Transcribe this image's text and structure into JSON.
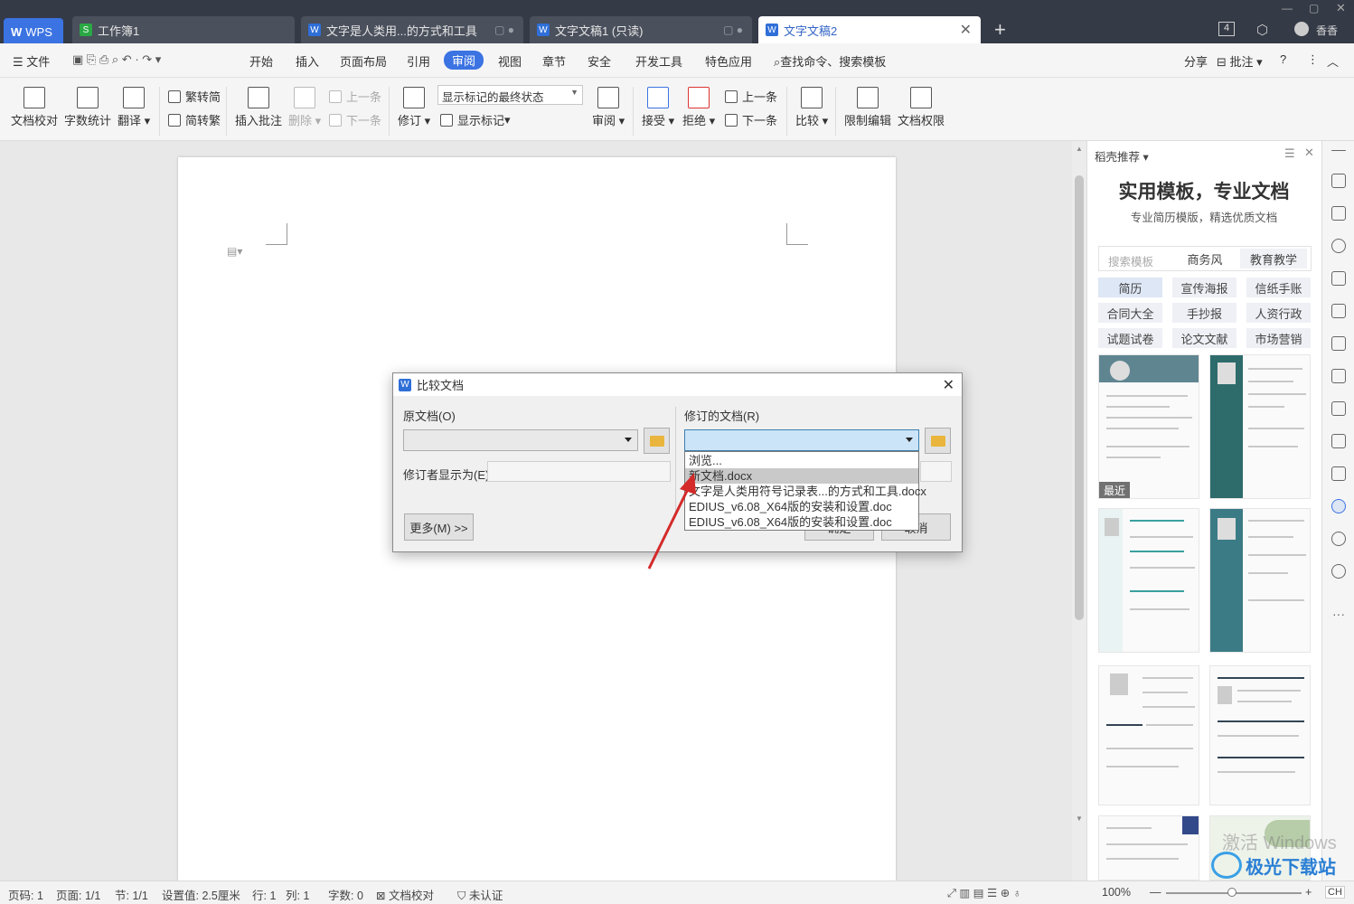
{
  "tabs": [
    {
      "label": "WPS"
    },
    {
      "label": "工作簿1"
    },
    {
      "label": "文字是人类用...的方式和工具"
    },
    {
      "label": "文字文稿1 (只读)"
    },
    {
      "label": "文字文稿2"
    }
  ],
  "titlebar": {
    "badge": "4",
    "user": "香香"
  },
  "menu": {
    "file": "文件",
    "items": [
      "开始",
      "插入",
      "页面布局",
      "引用",
      "审阅",
      "视图",
      "章节",
      "安全",
      "开发工具",
      "特色应用"
    ],
    "search": "查找命令、搜索模板",
    "share": "分享",
    "comment": "批注"
  },
  "ribbon": {
    "doc_check": "文档校对",
    "word_count": "字数统计",
    "translate": "翻译",
    "trad": "繁转简",
    "simp": "简转繁",
    "insert_comment": "插入批注",
    "delete": "删除",
    "prev": "上一条",
    "next": "下一条",
    "revise": "修订",
    "display_select": "显示标记的最终状态",
    "show_marks": "显示标记",
    "review": "审阅",
    "accept": "接受",
    "reject": "拒绝",
    "prev2": "上一条",
    "next2": "下一条",
    "compare": "比较",
    "restrict": "限制编辑",
    "perm": "文档权限"
  },
  "dialog": {
    "title": "比较文档",
    "original_label": "原文档(O)",
    "revised_label": "修订的文档(R)",
    "reviser_label": "修订者显示为(E)",
    "more": "更多(M) >>",
    "ok": "确定",
    "cancel": "取消",
    "dropdown": [
      "浏览...",
      "新文档.docx",
      "文字是人类用符号记录表...的方式和工具.docx",
      "EDIUS_v6.08_X64版的安装和设置.doc",
      "EDIUS_v6.08_X64版的安装和设置.doc"
    ]
  },
  "panel": {
    "header": "稻壳推荐",
    "title": "实用模板，专业文档",
    "subtitle": "专业简历模版，精选优质文档",
    "search_placeholder": "搜索模板",
    "chips": [
      "商务风",
      "教育教学",
      "简历",
      "宣传海报",
      "信纸手账",
      "合同大全",
      "手抄报",
      "人资行政",
      "试题试卷",
      "论文文献",
      "市场营销"
    ],
    "recent": "最近"
  },
  "status": {
    "page": "页码: 1",
    "pages": "页面: 1/1",
    "section": "节: 1/1",
    "setting": "设置值: 2.5厘米",
    "row": "行: 1",
    "col": "列: 1",
    "words": "字数: 0",
    "proof": "文档校对",
    "auth": "未认证",
    "zoom": "100%",
    "lang": "CH"
  },
  "watermark": "激活 Windows",
  "logo": "极光下载站"
}
